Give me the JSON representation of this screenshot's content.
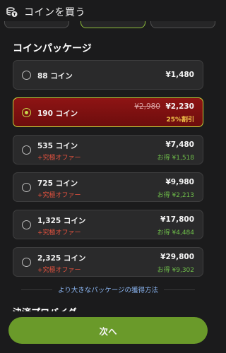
{
  "header": {
    "title": "コインを買う",
    "icon": "coin-stack-icon"
  },
  "section": {
    "title": "コインパッケージ"
  },
  "packages": [
    {
      "coins": "88 コイン",
      "price": "¥1,480",
      "selected": false
    },
    {
      "coins": "190 コイン",
      "price": "¥2,230",
      "old_price": "¥2,980",
      "discount": "25%割引",
      "selected": true
    },
    {
      "coins": "535 コイン",
      "offer": "+究極オファー",
      "price": "¥7,480",
      "savings": "お得 ¥1,518",
      "selected": false
    },
    {
      "coins": "725 コイン",
      "offer": "+究極オファー",
      "price": "¥9,980",
      "savings": "お得 ¥2,213",
      "selected": false
    },
    {
      "coins": "1,325 コイン",
      "offer": "+究極オファー",
      "price": "¥17,800",
      "savings": "お得 ¥4,484",
      "selected": false
    },
    {
      "coins": "2,325 コイン",
      "offer": "+究極オファー",
      "price": "¥29,800",
      "savings": "お得 ¥9,302",
      "selected": false
    }
  ],
  "more_link": "より大きなパッケージの獲得方法",
  "provider": {
    "title": "決済プロバイダー"
  },
  "next_button": "次へ",
  "colors": {
    "accent_green": "#6a9a2a",
    "selected_red": "#8e1414",
    "offer_red": "#e8533f",
    "savings_green": "#6fbf4a",
    "discount_yellow": "#f2c44a"
  }
}
